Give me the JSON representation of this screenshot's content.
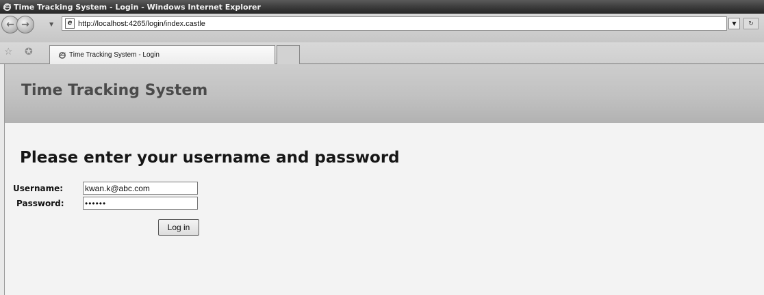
{
  "window": {
    "title": "Time Tracking System - Login - Windows Internet Explorer"
  },
  "addressbar": {
    "url": "http://localhost:4265/login/index.castle"
  },
  "tabs": [
    {
      "label": "Time Tracking System - Login",
      "active": true
    }
  ],
  "page": {
    "banner_title": "Time Tracking System",
    "heading": "Please enter your username and password",
    "form": {
      "username_label": "Username:",
      "username_value": "kwan.k@abc.com",
      "password_label": "Password:",
      "password_masked": "••••••",
      "login_button": "Log in"
    }
  },
  "colors": {
    "titlebar": "#3a3a3a",
    "banner": "#c1c1c1",
    "page_background": "#f3f3f3"
  },
  "icons": [
    "ie-logo-icon",
    "back-arrow-icon",
    "forward-arrow-icon",
    "page-icon",
    "favorites-star-icon",
    "add-favorites-icon",
    "refresh-icon"
  ]
}
